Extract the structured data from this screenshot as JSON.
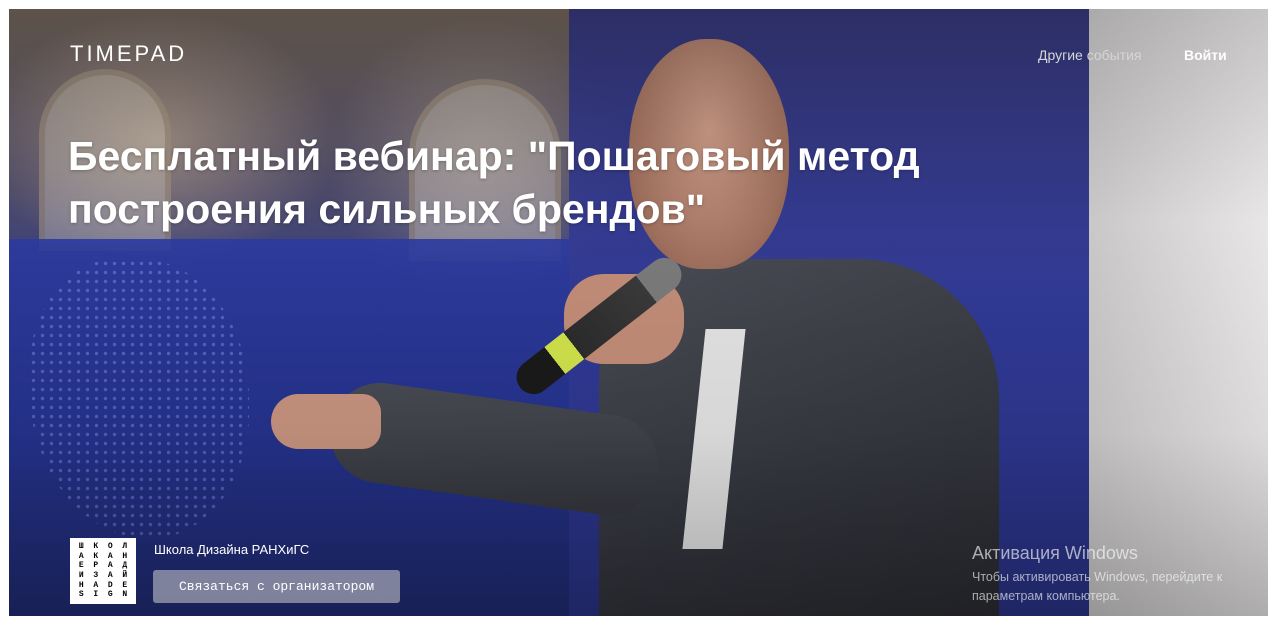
{
  "header": {
    "logo": "TIMEPAD",
    "nav": {
      "other_events": "Другие события",
      "login": "Войти"
    }
  },
  "event": {
    "title": "Бесплатный вебинар: \"Пошаговый метод построения сильных брендов\""
  },
  "organizer": {
    "logo_lines": [
      "ШКОЛА",
      "КАНЕРА",
      "ДИЗАЙНА",
      "DESIGN",
      "РАНХиГС",
      "SCHOOL"
    ],
    "name": "Школа Дизайна РАНХиГС",
    "contact_button": "Связаться с организатором"
  },
  "windows_activation": {
    "title": "Активация Windows",
    "line1": "Чтобы активировать Windows, перейдите к",
    "line2": "параметрам компьютера."
  },
  "colors": {
    "accent_text": "#ffffff",
    "button_bg": "#c8c8c8"
  }
}
